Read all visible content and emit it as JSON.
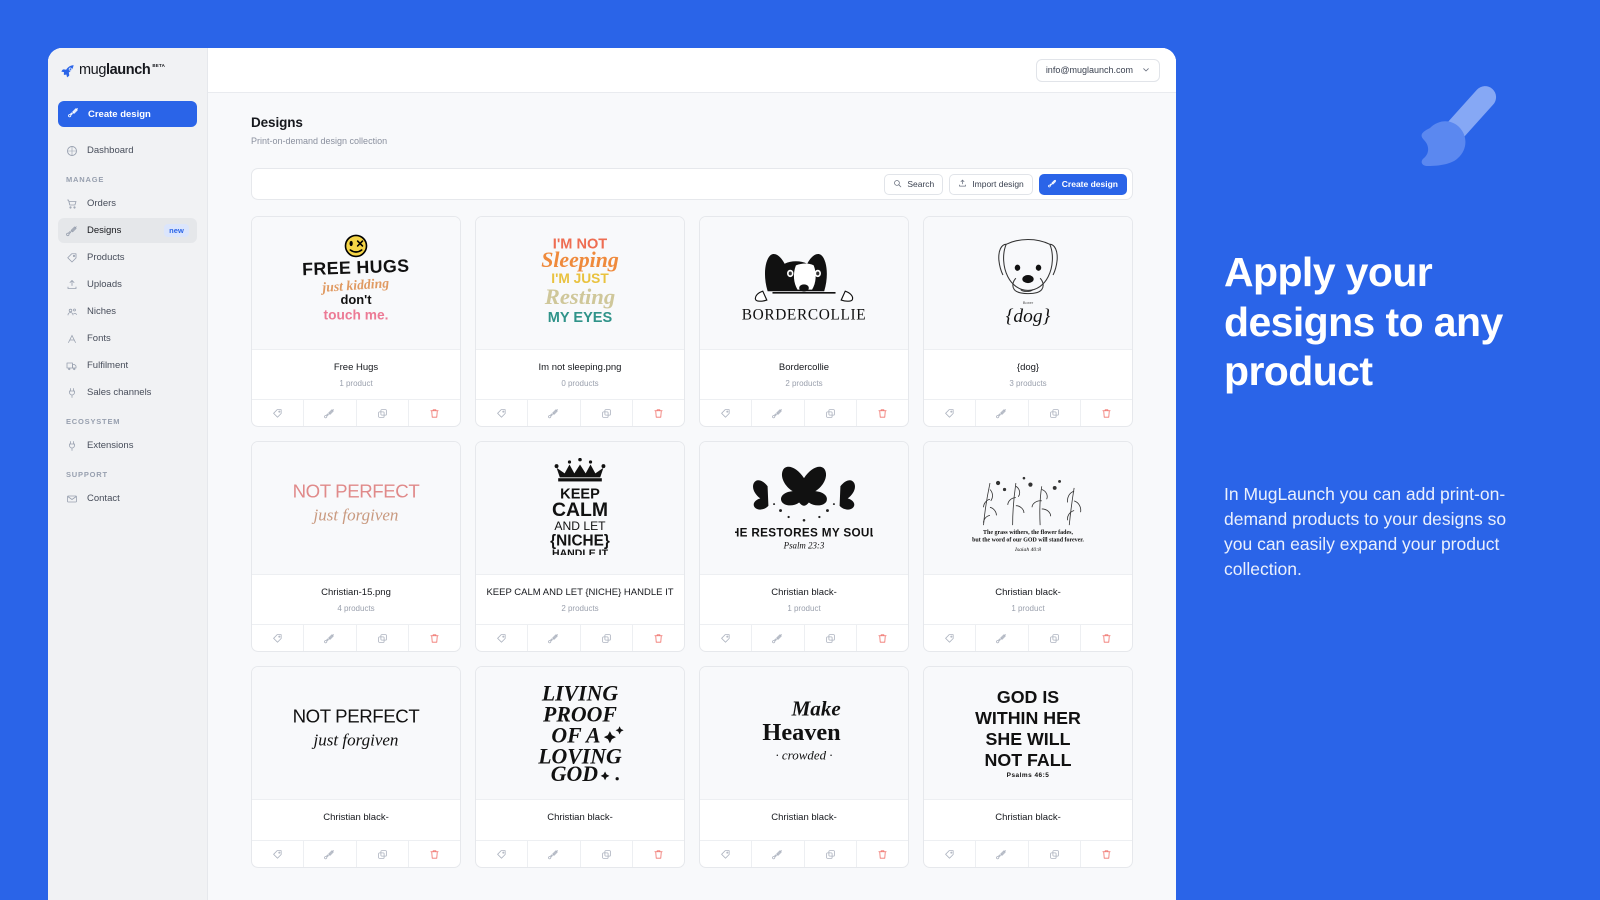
{
  "brand": {
    "name_light": "mug",
    "name_bold": "launch",
    "beta": "BETA",
    "accent": "#2a64e8"
  },
  "sidebar": {
    "cta": {
      "label": "Create design",
      "icon": "paintbrush-icon"
    },
    "primary": [
      {
        "label": "Dashboard",
        "icon": "dashboard-icon"
      }
    ],
    "sections": [
      {
        "title": "MANAGE",
        "items": [
          {
            "label": "Orders",
            "icon": "cart-icon",
            "active": false,
            "badge": ""
          },
          {
            "label": "Designs",
            "icon": "paintbrush-icon",
            "active": true,
            "badge": "new"
          },
          {
            "label": "Products",
            "icon": "tag-icon",
            "active": false,
            "badge": ""
          },
          {
            "label": "Uploads",
            "icon": "upload-icon",
            "active": false,
            "badge": ""
          },
          {
            "label": "Niches",
            "icon": "users-icon",
            "active": false,
            "badge": ""
          },
          {
            "label": "Fonts",
            "icon": "font-icon",
            "active": false,
            "badge": ""
          },
          {
            "label": "Fulfilment",
            "icon": "truck-icon",
            "active": false,
            "badge": ""
          },
          {
            "label": "Sales channels",
            "icon": "plug-icon",
            "active": false,
            "badge": ""
          }
        ]
      },
      {
        "title": "ECOSYSTEM",
        "items": [
          {
            "label": "Extensions",
            "icon": "plug-icon",
            "active": false,
            "badge": ""
          }
        ]
      },
      {
        "title": "SUPPORT",
        "items": [
          {
            "label": "Contact",
            "icon": "mail-icon",
            "active": false,
            "badge": ""
          }
        ]
      }
    ]
  },
  "topbar": {
    "account_email": "info@muglaunch.com",
    "chevron": "chevron-down-icon"
  },
  "header": {
    "title": "Designs",
    "subtitle": "Print-on-demand design collection"
  },
  "toolbar": {
    "search_label": "Search",
    "import_label": "Import design",
    "create_label": "Create design"
  },
  "card_actions": [
    {
      "name": "tag-action",
      "icon": "tag-icon"
    },
    {
      "name": "edit-action",
      "icon": "paintbrush-icon"
    },
    {
      "name": "duplicate-action",
      "icon": "copy-icon"
    },
    {
      "name": "delete-action",
      "icon": "trash-icon"
    }
  ],
  "designs": [
    {
      "title": "Free Hugs",
      "products": "1 product",
      "art": "free-hugs"
    },
    {
      "title": "Im not sleeping.png",
      "products": "0 products",
      "art": "im-not-sleeping"
    },
    {
      "title": "Bordercollie",
      "products": "2 products",
      "art": "bordercollie"
    },
    {
      "title": "{dog}",
      "products": "3 products",
      "art": "dog-boxer"
    },
    {
      "title": "Christian-15.png",
      "products": "4 products",
      "art": "not-perfect-pink"
    },
    {
      "title": "KEEP CALM AND LET {NICHE} HANDLE IT",
      "products": "2 products",
      "art": "keep-calm"
    },
    {
      "title": "Christian black-",
      "products": "1 product",
      "art": "he-restores"
    },
    {
      "title": "Christian black-",
      "products": "1 product",
      "art": "grass-withers"
    },
    {
      "title": "Christian black-",
      "products": "",
      "art": "not-perfect-black"
    },
    {
      "title": "Christian black-",
      "products": "",
      "art": "living-proof"
    },
    {
      "title": "Christian black-",
      "products": "",
      "art": "make-heaven"
    },
    {
      "title": "Christian black-",
      "products": "",
      "art": "god-is-within-her"
    }
  ],
  "art_text": {
    "free_hugs": {
      "l1": "FREE HUGS",
      "l2": "just kidding",
      "l3": "don't",
      "l4": "touch me."
    },
    "im_not_sleeping": {
      "l1": "I'M NOT",
      "l2": "Sleeping",
      "l3": "I'M JUST",
      "l4": "Resting",
      "l5": "MY EYES"
    },
    "bordercollie": {
      "l1": "BORDERCOLLIE"
    },
    "dog_boxer": {
      "l1": "Boxer",
      "l2": "{dog}"
    },
    "not_perfect": {
      "l1": "NOT PERFECT",
      "l2": "just forgiven"
    },
    "keep_calm": {
      "l1": "KEEP",
      "l2": "CALM",
      "l3": "AND LET",
      "l4": "{NICHE}",
      "l5": "HANDLE IT"
    },
    "he_restores": {
      "l1": "HE RESTORES MY SOUL",
      "l2": "Psalm 23:3"
    },
    "grass_withers": {
      "l1": "The grass withers, the flower fades,",
      "l2": "but the word of our GOD will stand forever.",
      "l3": "Isaiah 40:8"
    },
    "living_proof": {
      "l1": "LIVING",
      "l2": "PROOF",
      "l3": "OF A",
      "l4": "LOVING",
      "l5": "GOD"
    },
    "make_heaven": {
      "l1": "Make",
      "l2": "Heaven",
      "l3": "crowded"
    },
    "god_is_within_her": {
      "l1": "GOD IS",
      "l2": "WITHIN HER",
      "l3": "SHE WILL",
      "l4": "NOT FALL",
      "l5": "Psalms 46:5"
    }
  },
  "promo": {
    "headline": "Apply your designs to any product",
    "body": "In MugLaunch you can add print-on-demand products to your designs so you can easily expand your product collection.",
    "icon": "paintbrush-icon"
  }
}
